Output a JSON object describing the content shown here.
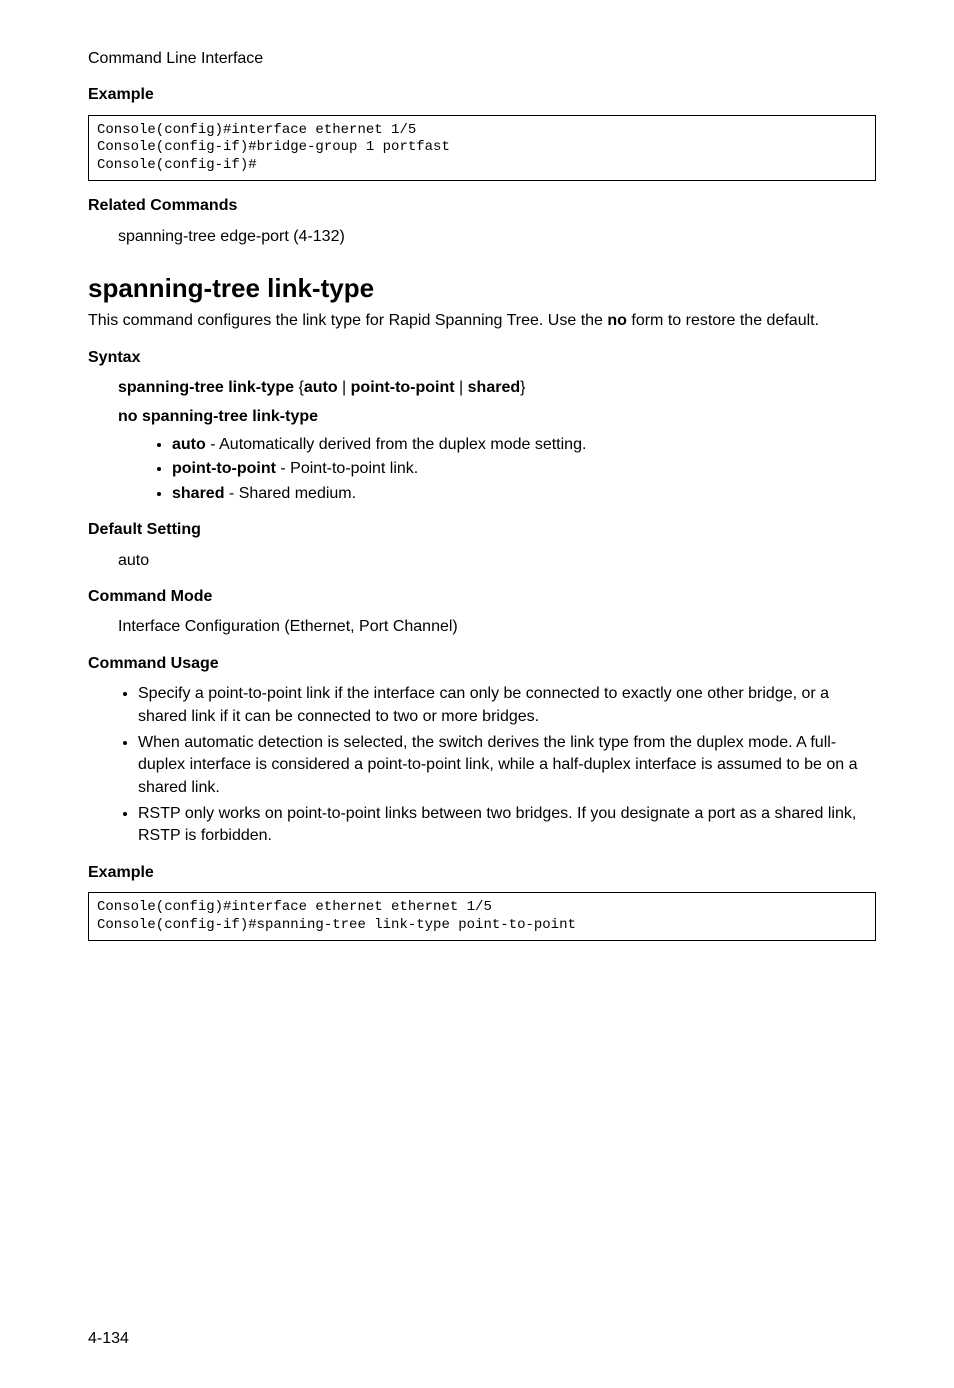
{
  "runningHead": "Command Line Interface",
  "sections": {
    "example1": {
      "label": "Example",
      "code": "Console(config)#interface ethernet 1/5\nConsole(config-if)#bridge-group 1 portfast\nConsole(config-if)#"
    },
    "relatedCommands": {
      "label": "Related Commands",
      "text": "spanning-tree edge-port (4-132)"
    },
    "commandTitle": "spanning-tree link-type",
    "intro": {
      "part1": "This command configures the link type for Rapid Spanning Tree. Use the ",
      "bold": "no",
      "part2": " form to restore the default."
    },
    "syntax": {
      "label": "Syntax",
      "line1": {
        "cmd": "spanning-tree link-type",
        "openBrace": " {",
        "opt1": "auto",
        "sep1": " | ",
        "opt2": "point-to-point",
        "sep2": " | ",
        "opt3": "shared",
        "closeBrace": "}"
      },
      "line2": "no spanning-tree link-type",
      "params": [
        {
          "kw": "auto",
          "desc": " - Automatically derived from the duplex mode setting."
        },
        {
          "kw": "point-to-point",
          "desc": " - Point-to-point link."
        },
        {
          "kw": "shared",
          "desc": " - Shared medium."
        }
      ]
    },
    "defaultSetting": {
      "label": "Default Setting",
      "text": "auto"
    },
    "commandMode": {
      "label": "Command Mode",
      "text": "Interface Configuration (Ethernet, Port Channel)"
    },
    "commandUsage": {
      "label": "Command Usage",
      "items": [
        "Specify a point-to-point link if the interface can only be connected to exactly one other bridge, or a shared link if it can be connected to two or more bridges.",
        "When automatic detection is selected, the switch derives the link type from the duplex mode. A full-duplex interface is considered a point-to-point link, while a half-duplex interface is assumed to be on a shared link.",
        "RSTP only works on point-to-point links between two bridges. If you designate a port as a shared link, RSTP is forbidden."
      ]
    },
    "example2": {
      "label": "Example",
      "code": "Console(config)#interface ethernet ethernet 1/5\nConsole(config-if)#spanning-tree link-type point-to-point"
    }
  },
  "pageNumber": "4-134"
}
